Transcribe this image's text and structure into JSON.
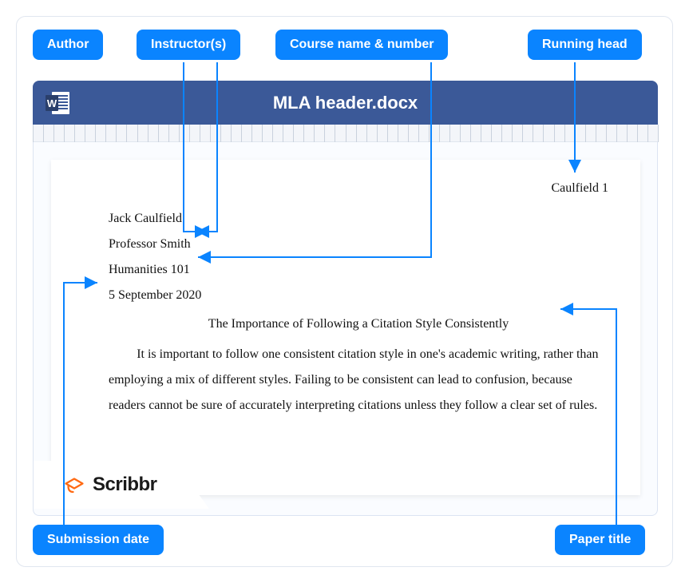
{
  "labels": {
    "author": "Author",
    "instructor": "Instructor(s)",
    "course": "Course name & number",
    "running_head": "Running head",
    "submission_date": "Submission date",
    "paper_title": "Paper title"
  },
  "titlebar": {
    "filename": "MLA header.docx"
  },
  "document": {
    "running_head": "Caulfield 1",
    "author": "Jack Caulfield",
    "instructor": "Professor Smith",
    "course": "Humanities 101",
    "date": "5 September 2020",
    "title": "The Importance of Following a Citation Style Consistently",
    "body": "It is important to follow one consistent citation style in one's academic writing, rather than employing a mix of different styles. Failing to be consistent can lead to confusion, because readers cannot be sure of accurately interpreting citations unless they follow a clear set of rules."
  },
  "branding": {
    "name": "Scribbr"
  }
}
